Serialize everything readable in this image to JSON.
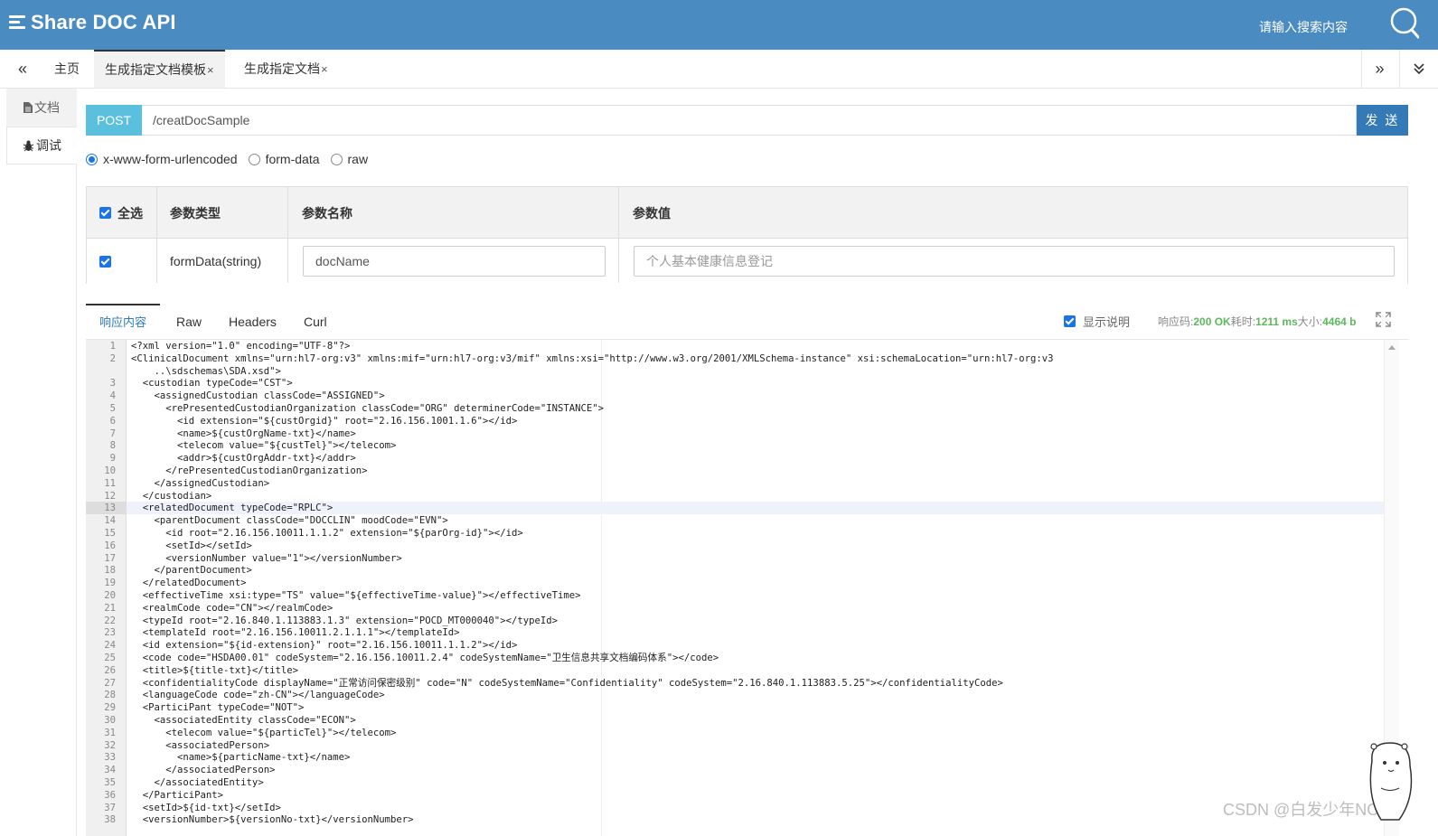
{
  "header": {
    "title": "Share DOC API",
    "search_placeholder": "请输入搜索内容"
  },
  "tabs": {
    "home": "主页",
    "items": [
      {
        "label": "生成指定文档模板",
        "close": "×",
        "active": true
      },
      {
        "label": "生成指定文档",
        "close": "×",
        "active": false
      }
    ]
  },
  "sidebar": {
    "doc": "文档",
    "debug": "调试"
  },
  "request": {
    "method": "POST",
    "url": "/creatDocSample",
    "send": "发 送"
  },
  "body_types": [
    {
      "label": "x-www-form-urlencoded",
      "checked": true
    },
    {
      "label": "form-data",
      "checked": false
    },
    {
      "label": "raw",
      "checked": false
    }
  ],
  "params": {
    "headers": {
      "select_all": "全选",
      "type": "参数类型",
      "name": "参数名称",
      "value": "参数值"
    },
    "rows": [
      {
        "checked": true,
        "type": "formData(string)",
        "name": "docName",
        "value_placeholder": "个人基本健康信息登记"
      }
    ]
  },
  "response": {
    "tabs": [
      "响应内容",
      "Raw",
      "Headers",
      "Curl"
    ],
    "show_desc": "显示说明",
    "status_label_code": "响应码:",
    "status_code": "200 OK",
    "status_label_time": "耗时:",
    "time": "1211 ms",
    "status_label_size": "大小:",
    "size": "4464 b"
  },
  "code": {
    "highlighted_line": 13,
    "lines": [
      {
        "n": "1",
        "t": "<?xml version=\"1.0\" encoding=\"UTF-8\"?>"
      },
      {
        "n": "2",
        "t": "<ClinicalDocument xmlns=\"urn:hl7-org:v3\" xmlns:mif=\"urn:hl7-org:v3/mif\" xmlns:xsi=\"http://www.w3.org/2001/XMLSchema-instance\" xsi:schemaLocation=\"urn:hl7-org:v3"
      },
      {
        "n": "",
        "t": "    ..\\sdschemas\\SDA.xsd\">"
      },
      {
        "n": "3",
        "t": "  <custodian typeCode=\"CST\">"
      },
      {
        "n": "4",
        "t": "    <assignedCustodian classCode=\"ASSIGNED\">"
      },
      {
        "n": "5",
        "t": "      <rePresentedCustodianOrganization classCode=\"ORG\" determinerCode=\"INSTANCE\">"
      },
      {
        "n": "6",
        "t": "        <id extension=\"${custOrgid}\" root=\"2.16.156.1001.1.6\"></id>"
      },
      {
        "n": "7",
        "t": "        <name>${custOrgName-txt}</name>"
      },
      {
        "n": "8",
        "t": "        <telecom value=\"${custTel}\"></telecom>"
      },
      {
        "n": "9",
        "t": "        <addr>${custOrgAddr-txt}</addr>"
      },
      {
        "n": "10",
        "t": "      </rePresentedCustodianOrganization>"
      },
      {
        "n": "11",
        "t": "    </assignedCustodian>"
      },
      {
        "n": "12",
        "t": "  </custodian>"
      },
      {
        "n": "13",
        "t": "  <relatedDocument typeCode=\"RPLC\">"
      },
      {
        "n": "14",
        "t": "    <parentDocument classCode=\"DOCCLIN\" moodCode=\"EVN\">"
      },
      {
        "n": "15",
        "t": "      <id root=\"2.16.156.10011.1.1.2\" extension=\"${parOrg-id}\"></id>"
      },
      {
        "n": "16",
        "t": "      <setId></setId>"
      },
      {
        "n": "17",
        "t": "      <versionNumber value=\"1\"></versionNumber>"
      },
      {
        "n": "18",
        "t": "    </parentDocument>"
      },
      {
        "n": "19",
        "t": "  </relatedDocument>"
      },
      {
        "n": "20",
        "t": "  <effectiveTime xsi:type=\"TS\" value=\"${effectiveTime-value}\"></effectiveTime>"
      },
      {
        "n": "21",
        "t": "  <realmCode code=\"CN\"></realmCode>"
      },
      {
        "n": "22",
        "t": "  <typeId root=\"2.16.840.1.113883.1.3\" extension=\"POCD_MT000040\"></typeId>"
      },
      {
        "n": "23",
        "t": "  <templateId root=\"2.16.156.10011.2.1.1.1\"></templateId>"
      },
      {
        "n": "24",
        "t": "  <id extension=\"${id-extension}\" root=\"2.16.156.10011.1.1.2\"></id>"
      },
      {
        "n": "25",
        "t": "  <code code=\"HSDA00.01\" codeSystem=\"2.16.156.10011.2.4\" codeSystemName=\"卫生信息共享文档编码体系\"></code>"
      },
      {
        "n": "26",
        "t": "  <title>${title-txt}</title>"
      },
      {
        "n": "27",
        "t": "  <confidentialityCode displayName=\"正常访问保密级别\" code=\"N\" codeSystemName=\"Confidentiality\" codeSystem=\"2.16.840.1.113883.5.25\"></confidentialityCode>"
      },
      {
        "n": "28",
        "t": "  <languageCode code=\"zh-CN\"></languageCode>"
      },
      {
        "n": "29",
        "t": "  <ParticiPant typeCode=\"NOT\">"
      },
      {
        "n": "30",
        "t": "    <associatedEntity classCode=\"ECON\">"
      },
      {
        "n": "31",
        "t": "      <telecom value=\"${particTel}\"></telecom>"
      },
      {
        "n": "32",
        "t": "      <associatedPerson>"
      },
      {
        "n": "33",
        "t": "        <name>${particName-txt}</name>"
      },
      {
        "n": "34",
        "t": "      </associatedPerson>"
      },
      {
        "n": "35",
        "t": "    </associatedEntity>"
      },
      {
        "n": "36",
        "t": "  </ParticiPant>"
      },
      {
        "n": "37",
        "t": "  <setId>${id-txt}</setId>"
      },
      {
        "n": "38",
        "t": "  <versionNumber>${versionNo-txt}</versionNumber>"
      }
    ]
  },
  "watermark": "CSDN @白发少年NO狂",
  "colors": {
    "header_bg": "#4a8bc2",
    "method_bg": "#5bc0de",
    "send_bg": "#337ab7",
    "status_green": "#5cb85c",
    "checkbox_blue": "#1a73e8"
  }
}
